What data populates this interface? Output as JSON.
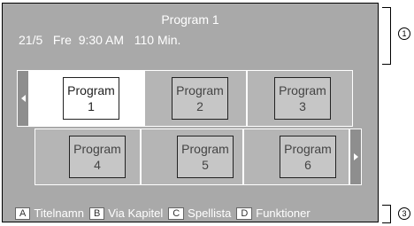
{
  "header": {
    "title": "Program 1",
    "info": "21/5   Fre  9:30 AM   110 Min."
  },
  "grid": {
    "row1": [
      {
        "line1": "Program",
        "line2": "1",
        "selected": true
      },
      {
        "line1": "Program",
        "line2": "2",
        "selected": false
      },
      {
        "line1": "Program",
        "line2": "3",
        "selected": false
      }
    ],
    "row2": [
      {
        "line1": "Program",
        "line2": "4",
        "selected": false
      },
      {
        "line1": "Program",
        "line2": "5",
        "selected": false
      },
      {
        "line1": "Program",
        "line2": "6",
        "selected": false
      }
    ]
  },
  "footer": {
    "items": [
      {
        "key": "A",
        "label": "Titelnamn"
      },
      {
        "key": "B",
        "label": "Via Kapitel"
      },
      {
        "key": "C",
        "label": "Spellista"
      },
      {
        "key": "D",
        "label": "Funktioner"
      }
    ]
  },
  "markers": {
    "m1": "1",
    "m3": "3"
  },
  "icons": {
    "prev": "arrow-left-icon",
    "next": "arrow-right-icon"
  }
}
